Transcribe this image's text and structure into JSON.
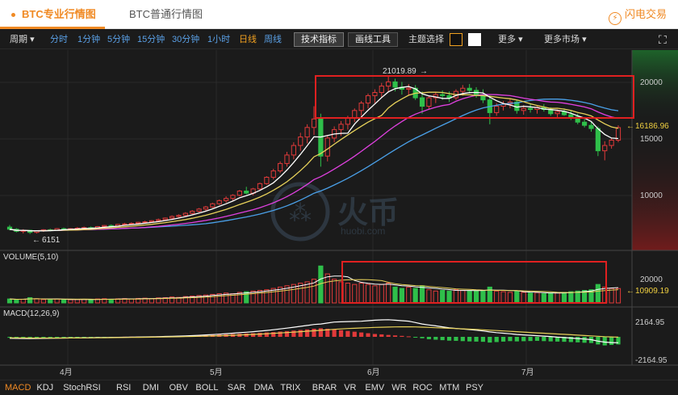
{
  "tabs": {
    "pro": "BTC专业行情图",
    "basic": "BTC普通行情图",
    "flash": "闪电交易"
  },
  "toolbar": {
    "period": "周期",
    "intervals": [
      "分时",
      "1分钟",
      "5分钟",
      "15分钟",
      "30分钟",
      "1小时",
      "日线",
      "周线"
    ],
    "active_interval": "日线",
    "tech_indicator": "技术指标",
    "draw_tool": "画线工具",
    "theme": "主题选择",
    "more": "更多",
    "more_markets": "更多市场"
  },
  "watermark": {
    "brand": "火币",
    "site": "huobi.com"
  },
  "indicators": [
    "MACD",
    "KDJ",
    "StochRSI",
    "RSI",
    "DMI",
    "OBV",
    "BOLL",
    "SAR",
    "DMA",
    "TRIX",
    "BRAR",
    "VR",
    "EMV",
    "WR",
    "ROC",
    "MTM",
    "PSY"
  ],
  "active_indicator": "MACD",
  "colors": {
    "up": "#e03a3a",
    "down": "#2fbf4a",
    "accent": "#f08a24",
    "ma5": "#ffffff",
    "ma10": "#e8d25a",
    "ma20": "#e040e0",
    "ma30": "#4aa0e8"
  },
  "chart_data": {
    "type": "candlestick",
    "x_labels": [
      "4月",
      "5月",
      "6月",
      "7月"
    ],
    "price_axis": [
      "20000",
      "15000",
      "10000"
    ],
    "price_range": [
      4600,
      23500
    ],
    "high_label": "21019.89",
    "low_label": "6151",
    "current_price": "16186.96",
    "volume_title": "VOLUME(5,10)",
    "volume_axis": [
      "20000"
    ],
    "volume_current": "10909.19",
    "volume_max": 30000,
    "macd_title": "MACD(12,26,9)",
    "macd_axis": [
      "2164.95",
      "-2164.95"
    ],
    "macd_range": [
      -2800,
      2800
    ],
    "candles": [
      [
        6800,
        7000,
        6500,
        6600
      ],
      [
        6600,
        6700,
        6300,
        6400
      ],
      [
        6400,
        6600,
        6200,
        6500
      ],
      [
        6500,
        6550,
        6151,
        6300
      ],
      [
        6300,
        6500,
        6200,
        6450
      ],
      [
        6450,
        6600,
        6350,
        6550
      ],
      [
        6550,
        6650,
        6400,
        6500
      ],
      [
        6500,
        6700,
        6450,
        6650
      ],
      [
        6650,
        6750,
        6500,
        6600
      ],
      [
        6600,
        6700,
        6500,
        6650
      ],
      [
        6650,
        6800,
        6550,
        6700
      ],
      [
        6700,
        6850,
        6600,
        6750
      ],
      [
        6750,
        6850,
        6650,
        6700
      ],
      [
        6700,
        6900,
        6650,
        6850
      ],
      [
        6850,
        7000,
        6750,
        6950
      ],
      [
        6950,
        7050,
        6800,
        6900
      ],
      [
        6900,
        7100,
        6850,
        7050
      ],
      [
        7050,
        7200,
        6950,
        7100
      ],
      [
        7100,
        7250,
        7000,
        7150
      ],
      [
        7150,
        7300,
        7050,
        7250
      ],
      [
        7250,
        7400,
        7150,
        7300
      ],
      [
        7300,
        7450,
        7200,
        7400
      ],
      [
        7400,
        7600,
        7300,
        7500
      ],
      [
        7500,
        7700,
        7400,
        7650
      ],
      [
        7650,
        7900,
        7550,
        7800
      ],
      [
        7800,
        8000,
        7700,
        7900
      ],
      [
        7900,
        8200,
        7800,
        8100
      ],
      [
        8100,
        8400,
        8000,
        8300
      ],
      [
        8300,
        8600,
        8200,
        8500
      ],
      [
        8500,
        8800,
        8300,
        8700
      ],
      [
        8700,
        9100,
        8600,
        9000
      ],
      [
        9000,
        9400,
        8900,
        9300
      ],
      [
        9300,
        9700,
        9100,
        9500
      ],
      [
        9500,
        9900,
        9300,
        9800
      ],
      [
        9800,
        10300,
        9700,
        10200
      ],
      [
        10200,
        10600,
        9900,
        10000
      ],
      [
        10000,
        10500,
        9800,
        10400
      ],
      [
        10400,
        11000,
        10300,
        10900
      ],
      [
        10900,
        11600,
        10800,
        11500
      ],
      [
        11500,
        12300,
        11300,
        12100
      ],
      [
        12100,
        13000,
        11900,
        12800
      ],
      [
        12800,
        13900,
        12500,
        13600
      ],
      [
        13600,
        14800,
        13200,
        14500
      ],
      [
        14500,
        15700,
        14000,
        15300
      ],
      [
        15300,
        16500,
        14700,
        16200
      ],
      [
        16200,
        18200,
        15500,
        17000
      ],
      [
        17000,
        17500,
        12500,
        13500
      ],
      [
        13500,
        15500,
        13000,
        15200
      ],
      [
        15200,
        16300,
        14800,
        16000
      ],
      [
        16000,
        16800,
        15400,
        16500
      ],
      [
        16500,
        17300,
        16000,
        17100
      ],
      [
        17100,
        18000,
        16700,
        17800
      ],
      [
        17800,
        18700,
        17300,
        18500
      ],
      [
        18500,
        19400,
        18000,
        19200
      ],
      [
        19200,
        19800,
        18500,
        19500
      ],
      [
        19500,
        20400,
        19000,
        20100
      ],
      [
        20100,
        21019,
        19500,
        20500
      ],
      [
        20500,
        20800,
        19600,
        20000
      ],
      [
        20000,
        20500,
        19300,
        19800
      ],
      [
        19800,
        20300,
        19200,
        19900
      ],
      [
        19900,
        20200,
        18800,
        19000
      ],
      [
        19000,
        19600,
        17500,
        18200
      ],
      [
        18200,
        19200,
        17900,
        19000
      ],
      [
        19000,
        19500,
        18500,
        19300
      ],
      [
        19300,
        19700,
        18800,
        19200
      ],
      [
        19200,
        19600,
        18600,
        19000
      ],
      [
        19000,
        19800,
        18800,
        19600
      ],
      [
        19600,
        20200,
        19200,
        19900
      ],
      [
        19900,
        20300,
        19400,
        19700
      ],
      [
        19700,
        20000,
        19000,
        19300
      ],
      [
        19300,
        19800,
        18500,
        18800
      ],
      [
        18800,
        19200,
        16500,
        17600
      ],
      [
        17600,
        18500,
        17300,
        18200
      ],
      [
        18200,
        18700,
        17800,
        18400
      ],
      [
        18400,
        18900,
        18000,
        18600
      ],
      [
        18600,
        18800,
        17500,
        17800
      ],
      [
        17800,
        18300,
        17400,
        18000
      ],
      [
        18000,
        18400,
        17600,
        17900
      ],
      [
        17900,
        18200,
        17500,
        18100
      ],
      [
        18100,
        18400,
        17700,
        17900
      ],
      [
        17900,
        18100,
        17300,
        17500
      ],
      [
        17500,
        17900,
        17100,
        17700
      ],
      [
        17700,
        18000,
        17300,
        17400
      ],
      [
        17400,
        17800,
        16900,
        17200
      ],
      [
        17200,
        17500,
        16500,
        16700
      ],
      [
        16700,
        17000,
        16200,
        16400
      ],
      [
        16400,
        16800,
        15800,
        16100
      ],
      [
        16100,
        16300,
        13500,
        14000
      ],
      [
        14000,
        14900,
        13100,
        14500
      ],
      [
        14500,
        15200,
        14200,
        15000
      ],
      [
        15000,
        16400,
        14800,
        16187
      ]
    ],
    "volume": [
      3000,
      2500,
      2800,
      4000,
      3200,
      2600,
      2400,
      3000,
      2800,
      2500,
      2600,
      2700,
      2400,
      3000,
      3200,
      2800,
      3100,
      3300,
      3000,
      3400,
      3600,
      3200,
      3800,
      4000,
      4500,
      4200,
      4800,
      5200,
      5600,
      6000,
      6500,
      7000,
      7500,
      7000,
      8000,
      8500,
      9000,
      9500,
      10000,
      11000,
      12000,
      13000,
      14000,
      15000,
      16000,
      18000,
      28000,
      22000,
      18000,
      16000,
      15000,
      14000,
      15000,
      14000,
      13000,
      14000,
      15000,
      12000,
      11000,
      12000,
      11000,
      13000,
      10000,
      9000,
      9500,
      9000,
      10000,
      9500,
      9000,
      9000,
      9500,
      12000,
      9000,
      8500,
      8000,
      9000,
      8000,
      7500,
      7800,
      7000,
      7500,
      7800,
      8000,
      8500,
      9000,
      9500,
      10000,
      14000,
      12000,
      11000,
      10909
    ],
    "macd": [
      -100,
      -110,
      -120,
      -130,
      -120,
      -110,
      -100,
      -90,
      -80,
      -70,
      -60,
      -50,
      -40,
      -30,
      -20,
      -10,
      0,
      10,
      20,
      30,
      40,
      50,
      60,
      70,
      80,
      100,
      120,
      140,
      160,
      180,
      200,
      230,
      260,
      290,
      320,
      350,
      380,
      420,
      460,
      500,
      550,
      600,
      660,
      720,
      780,
      850,
      900,
      850,
      780,
      700,
      620,
      540,
      460,
      380,
      300,
      260,
      200,
      150,
      100,
      50,
      -50,
      -150,
      -250,
      -300,
      -350,
      -400,
      -420,
      -450,
      -480,
      -500,
      -520,
      -600,
      -550,
      -500,
      -450,
      -480,
      -460,
      -440,
      -420,
      -450,
      -480,
      -500,
      -520,
      -550,
      -580,
      -620,
      -650,
      -800,
      -900,
      -850,
      -800
    ],
    "dif": [
      -150,
      -160,
      -170,
      -175,
      -170,
      -160,
      -150,
      -140,
      -130,
      -120,
      -110,
      -100,
      -90,
      -80,
      -70,
      -60,
      -50,
      -40,
      -30,
      -20,
      -10,
      0,
      20,
      40,
      60,
      80,
      100,
      130,
      160,
      200,
      240,
      280,
      330,
      380,
      430,
      480,
      540,
      600,
      670,
      750,
      830,
      920,
      1010,
      1100,
      1200,
      1300,
      1350,
      1450,
      1550,
      1580,
      1600,
      1620,
      1640,
      1700,
      1750,
      1780,
      1800,
      1750,
      1700,
      1650,
      1500,
      1350,
      1250,
      1150,
      1050,
      950,
      880,
      820,
      760,
      700,
      620,
      520,
      440,
      380,
      320,
      250,
      200,
      160,
      120,
      80,
      30,
      -30,
      -80,
      -130,
      -180,
      -230,
      -300,
      -450,
      -550,
      -600,
      -620
    ],
    "dea": [
      -100,
      -110,
      -120,
      -125,
      -130,
      -130,
      -130,
      -128,
      -125,
      -120,
      -115,
      -110,
      -105,
      -98,
      -90,
      -82,
      -74,
      -66,
      -58,
      -50,
      -42,
      -34,
      -24,
      -12,
      0,
      12,
      26,
      40,
      56,
      74,
      94,
      116,
      140,
      166,
      194,
      224,
      256,
      290,
      326,
      364,
      404,
      448,
      492,
      540,
      590,
      640,
      690,
      740,
      790,
      830,
      870,
      900,
      930,
      960,
      990,
      1010,
      1030,
      1040,
      1050,
      1050,
      1040,
      1020,
      990,
      960,
      930,
      900,
      870,
      840,
      810,
      780,
      740,
      700,
      660,
      620,
      580,
      540,
      500,
      460,
      420,
      380,
      340,
      300,
      260,
      220,
      180,
      140,
      100,
      60,
      20,
      -10,
      -30
    ]
  }
}
